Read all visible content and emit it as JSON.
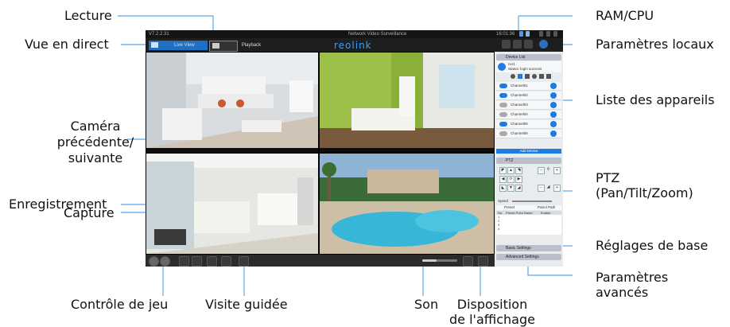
{
  "annotations": {
    "lecture": "Lecture",
    "vue_en_direct": "Vue en direct",
    "camera_prec_1": "Caméra",
    "camera_prec_2": "précédente/",
    "camera_prec_3": "suivante",
    "enregistrement": "Enregistrement",
    "capture": "Capture",
    "controle_de_jeu": "Contrôle de jeu",
    "visite_guidee": "Visite guidée",
    "son": "Son",
    "disposition_1": "Disposition",
    "disposition_2": "de l'affichage",
    "ram_cpu": "RAM/CPU",
    "parametres_locaux": "Paramètres locaux",
    "liste_appareils": "Liste des appareils",
    "ptz_1": "PTZ",
    "ptz_2": "(Pan/Tilt/Zoom)",
    "reglages_base": "Réglages de base",
    "parametres_avances_1": "Paramètres",
    "parametres_avances_2": "avancés"
  },
  "app": {
    "version": "V7.2.2.31",
    "window_title": "Network Video Surveillance",
    "time": "16:01:36",
    "live_view_label": "Live View",
    "playback_label": "Playback",
    "logo": "reolink"
  },
  "device_panel": {
    "title": "Device List",
    "device_name": "nvr1",
    "device_status": "Status: login success",
    "channels": [
      "Channel01",
      "Channel02",
      "Channel03",
      "Channel04",
      "Channel05",
      "Channel06"
    ],
    "add_device": "Add Device"
  },
  "ptz_panel": {
    "title": "PTZ",
    "speed_label": "Speed",
    "preset_label": "Preset",
    "patrol_label": "Patrol Path",
    "table_headers": [
      "No.",
      "Preset Point Name",
      "Enable"
    ],
    "rows": [
      "1",
      "2",
      "3",
      "4"
    ]
  },
  "settings": {
    "basic": "Basic Settings",
    "advanced": "Advanced Settings"
  },
  "colors": {
    "accent": "#1e7be0",
    "annotation_line": "#5aa7e6"
  }
}
